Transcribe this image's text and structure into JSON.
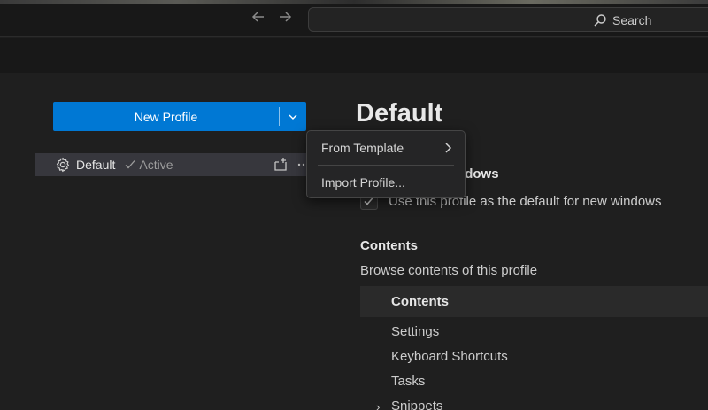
{
  "titlebar": {
    "back_icon": "arrow-left-icon",
    "forward_icon": "arrow-right-icon",
    "search_label": "Search",
    "search_icon": "search-icon"
  },
  "left": {
    "new_profile_label": "New Profile",
    "profiles": [
      {
        "name": "Default",
        "status": "Active",
        "icon": "gear-icon"
      }
    ]
  },
  "menu": {
    "items": [
      {
        "label": "From Template",
        "has_submenu": true
      },
      {
        "label": "Import Profile..."
      }
    ]
  },
  "right": {
    "title": "Default",
    "windows_heading": "Use for New Windows",
    "default_checkbox_label": "Use this profile as the default for new windows",
    "default_checked": true,
    "contents_heading": "Contents",
    "contents_desc": "Browse contents of this profile",
    "contents_tree_header": "Contents",
    "tree_items": [
      "Settings",
      "Keyboard Shortcuts",
      "Tasks",
      "Snippets"
    ]
  },
  "colors": {
    "accent": "#0078d4",
    "background": "#1f1f1f",
    "menu_bg": "#252526"
  }
}
